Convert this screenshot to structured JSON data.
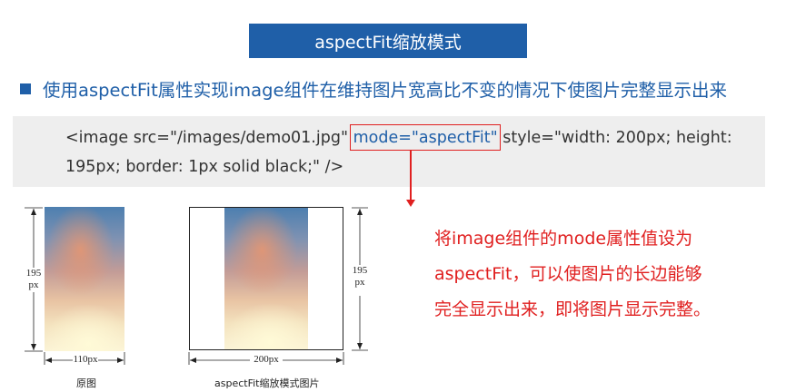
{
  "title": "aspectFit缩放模式",
  "subtitle": "使用aspectFit属性实现image组件在维持图片宽高比不变的情况下使图片完整显示出来",
  "code": {
    "line1_before": "<image src=\"/images/demo01.jpg\" ",
    "line1_highlight": "mode=\"aspectFit\"",
    "line1_after": " style=\"width: 200px; height:",
    "line2": "195px; border: 1px solid black;\" />"
  },
  "explanation": {
    "line1": "将image组件的mode属性值设为",
    "line2": "aspectFit，可以使图片的长边能够",
    "line3": "完全显示出来，即将图片显示完整。"
  },
  "figure_left": {
    "height_value": "195",
    "height_unit": "px",
    "width_label": "110px",
    "caption": "原图"
  },
  "figure_right": {
    "height_value": "195",
    "height_unit": "px",
    "width_label": "200px",
    "caption": "aspectFit缩放模式图片"
  },
  "colors": {
    "brand_blue": "#1f5fa8",
    "highlight_red": "#e02020",
    "code_bg": "#eeeeee"
  }
}
